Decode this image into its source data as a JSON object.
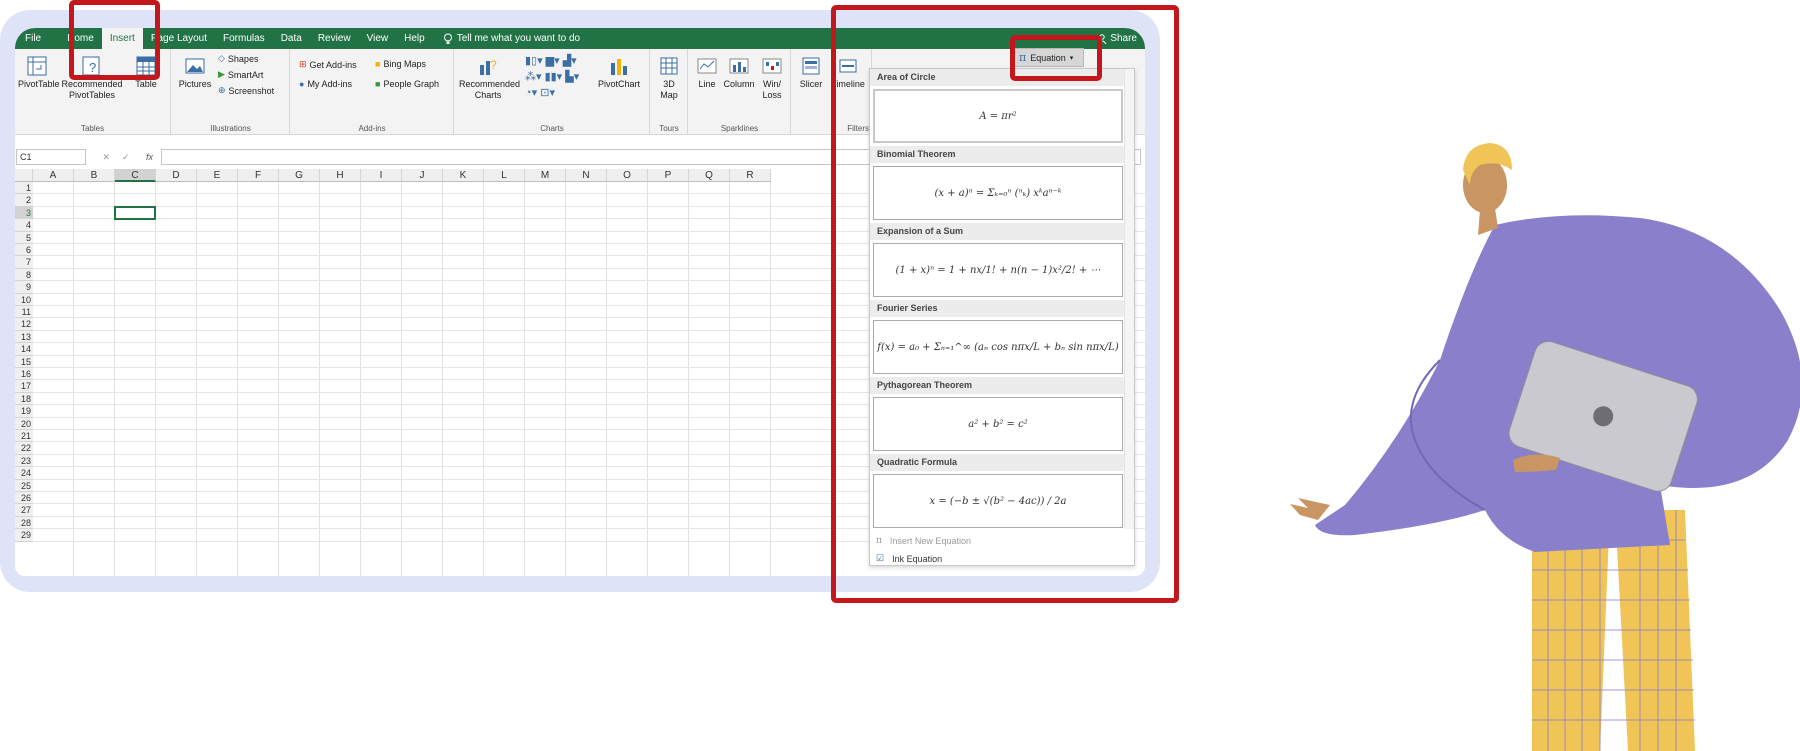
{
  "tabs": [
    {
      "label": "File"
    },
    {
      "label": "Home"
    },
    {
      "label": "Insert"
    },
    {
      "label": "Page Layout"
    },
    {
      "label": "Formulas"
    },
    {
      "label": "Data"
    },
    {
      "label": "Review"
    },
    {
      "label": "View"
    },
    {
      "label": "Help"
    }
  ],
  "tell_me": "Tell me what you want to do",
  "share": "Share",
  "ribbon": {
    "tables": {
      "pivot": "PivotTable",
      "recommended": "Recommended PivotTables",
      "table": "Table",
      "group": "Tables"
    },
    "illustrations": {
      "pictures": "Pictures",
      "shapes": "Shapes",
      "smartart": "SmartArt",
      "screenshot": "Screenshot",
      "group": "Illustrations"
    },
    "addins": {
      "get": "Get Add-ins",
      "bing": "Bing Maps",
      "my": "My Add-ins",
      "people": "People Graph",
      "group": "Add-ins"
    },
    "charts": {
      "recommended": "Recommended Charts",
      "pivotchart": "PivotChart",
      "group": "Charts"
    },
    "tours": {
      "map": "3D Map",
      "group": "Tours"
    },
    "sparklines": {
      "line": "Line",
      "column": "Column",
      "winloss": "Win/ Loss",
      "group": "Sparklines"
    },
    "filters": {
      "slicer": "Slicer",
      "timeline": "Timeline",
      "group": "Filters"
    },
    "equation": "Equation"
  },
  "namebox": "C1",
  "columns": [
    "A",
    "B",
    "C",
    "D",
    "E",
    "F",
    "G",
    "H",
    "I",
    "J",
    "K",
    "L",
    "M",
    "N",
    "O",
    "P",
    "Q",
    "R"
  ],
  "rows": [
    "1",
    "2",
    "3",
    "4",
    "5",
    "6",
    "7",
    "8",
    "9",
    "10",
    "11",
    "12",
    "13",
    "14",
    "15",
    "16",
    "17",
    "18",
    "19",
    "20",
    "21",
    "22",
    "23",
    "24",
    "25",
    "26",
    "27",
    "28",
    "29"
  ],
  "equations": [
    {
      "title": "Area of Circle",
      "formula": "A = πr²"
    },
    {
      "title": "Binomial Theorem",
      "formula": "(x + a)ⁿ = Σₖ₌₀ⁿ (ⁿₖ) xᵏaⁿ⁻ᵏ"
    },
    {
      "title": "Expansion of a Sum",
      "formula": "(1 + x)ⁿ = 1 + nx/1! + n(n − 1)x²/2! + ⋯"
    },
    {
      "title": "Fourier Series",
      "formula": "f(x) = a₀ + Σₙ₌₁^∞ (aₙ cos nπx/L + bₙ sin nπx/L)"
    },
    {
      "title": "Pythagorean Theorem",
      "formula": "a² + b² = c²"
    },
    {
      "title": "Quadratic Formula",
      "formula": "x = (−b ± √(b² − 4ac)) / 2a"
    }
  ],
  "footer": {
    "insert_new": "Insert New Equation",
    "ink": "Ink Equation"
  },
  "colors": {
    "excel_green": "#217346",
    "highlight_red": "#c4171b",
    "frame": "#dfe3f7",
    "shirt": "#8a7fcb",
    "pants": "#f0c457"
  }
}
